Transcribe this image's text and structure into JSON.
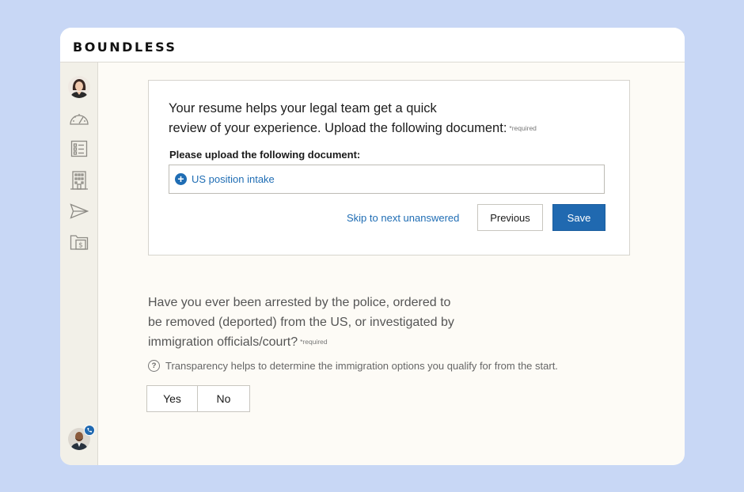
{
  "app": {
    "logo": "BOUNDLESS"
  },
  "sidebar": {
    "icons": [
      "user-avatar",
      "dashboard-gauge-icon",
      "form-list-icon",
      "building-icon",
      "send-icon",
      "folder-dollar-icon"
    ],
    "bottom_avatar": "attorney-avatar",
    "badge_icon": "phone-icon"
  },
  "upload_card": {
    "question_line1": "Your resume helps your legal team get a quick",
    "question_line2": "review of your experience. Upload the following document:",
    "required": "*required",
    "upload_label": "Please upload the following document:",
    "upload_item": "US position intake",
    "skip_link": "Skip to next unanswered",
    "previous_button": "Previous",
    "save_button": "Save"
  },
  "arrest_question": {
    "line1": "Have you ever been arrested by the police, ordered to",
    "line2": "be removed (deported) from the US, or investigated by",
    "line3": "immigration officials/court?",
    "required": "*required",
    "hint": "Transparency helps to determine the immigration options you qualify for from the start.",
    "yes": "Yes",
    "no": "No"
  },
  "colors": {
    "accent": "#2069b0",
    "background": "#c8d7f5",
    "panel": "#fdfbf6"
  }
}
